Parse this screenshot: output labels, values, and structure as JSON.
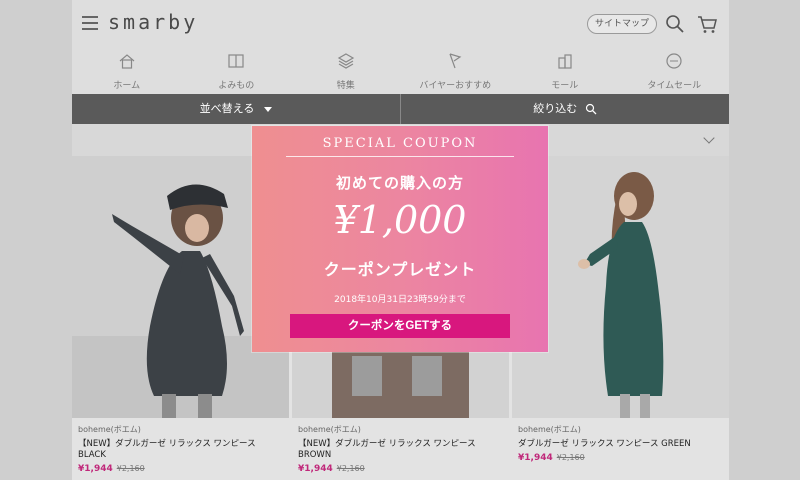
{
  "header": {
    "logo": "smarby",
    "sitemap_label": "サイトマップ"
  },
  "nav": {
    "items": [
      {
        "label": "ホーム",
        "icon": "home-icon"
      },
      {
        "label": "よみもの",
        "icon": "book-icon"
      },
      {
        "label": "特集",
        "icon": "layers-icon"
      },
      {
        "label": "バイヤーおすすめ",
        "icon": "flag-icon"
      },
      {
        "label": "モール",
        "icon": "building-icon"
      },
      {
        "label": "タイムセール",
        "icon": "sale-tag-icon"
      }
    ]
  },
  "toolbar": {
    "sort_label": "並べ替える",
    "filter_label": "絞り込む"
  },
  "products": [
    {
      "brand": "boheme(ボエム)",
      "name_line1": "【NEW】ダブルガーゼ リラックス ワンピース",
      "name_line2": "BLACK",
      "price": "¥1,944",
      "old_price": "¥2,160"
    },
    {
      "brand": "boheme(ボエム)",
      "name_line1": "【NEW】ダブルガーゼ リラックス ワンピース",
      "name_line2": "BROWN",
      "price": "¥1,944",
      "old_price": "¥2,160"
    },
    {
      "brand": "boheme(ボエム)",
      "name_line1": "ダブルガーゼ リラックス ワンピース GREEN",
      "name_line2": "",
      "price": "¥1,944",
      "old_price": "¥2,160"
    }
  ],
  "coupon": {
    "heading": "SPECIAL COUPON",
    "lead": "初めての購入の方",
    "amount": "¥1,000",
    "subtitle": "クーポンプレゼント",
    "deadline": "2018年10月31日23時59分まで",
    "cta_label": "クーポンをGETする"
  },
  "colors": {
    "accent": "#d8177e",
    "coupon_gradient_start": "#ef8f90",
    "coupon_gradient_end": "#e874b0",
    "bar": "#5a5a5a"
  }
}
